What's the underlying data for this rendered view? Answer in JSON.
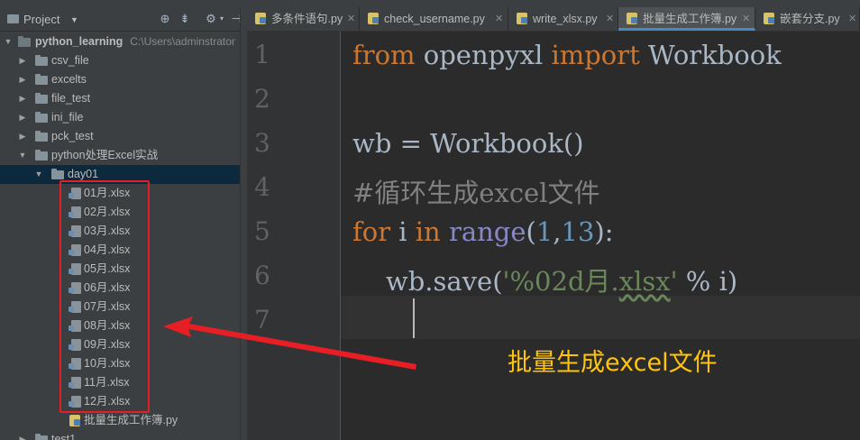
{
  "project_panel": {
    "title": "Project",
    "root": {
      "label": "python_learning",
      "path": "C:\\Users\\adminstrator"
    },
    "folders": [
      "csv_file",
      "excelts",
      "file_test",
      "ini_file",
      "pck_test",
      "python处理Excel实战"
    ],
    "subfolder": "day01",
    "files": [
      "01月.xlsx",
      "02月.xlsx",
      "03月.xlsx",
      "04月.xlsx",
      "05月.xlsx",
      "06月.xlsx",
      "07月.xlsx",
      "08月.xlsx",
      "09月.xlsx",
      "10月.xlsx",
      "11月.xlsx",
      "12月.xlsx"
    ],
    "script": "批量生成工作簿.py",
    "partial_next": "test1"
  },
  "tabs": [
    {
      "label": "多条件语句.py",
      "active": false
    },
    {
      "label": "check_username.py",
      "active": false
    },
    {
      "label": "write_xlsx.py",
      "active": false
    },
    {
      "label": "批量生成工作簿.py",
      "active": true
    },
    {
      "label": "嵌套分支.py",
      "active": false
    }
  ],
  "editor": {
    "line_numbers": [
      "1",
      "2",
      "3",
      "4",
      "5",
      "6",
      "7"
    ],
    "code": {
      "l1_kw1": "from",
      "l1_mod": " openpyxl ",
      "l1_kw2": "import",
      "l1_name": " Workbook",
      "l3": "wb = Workbook()",
      "l4": "#循环生成excel文件",
      "l5_kw1": "for",
      "l5_var": " i ",
      "l5_kw2": "in",
      "l5_sp": " ",
      "l5_fn": "range",
      "l5_p1": "(",
      "l5_n1": "1",
      "l5_c": ",",
      "l5_n2": "13",
      "l5_p2": "):",
      "l6_pre": "    wb.save(",
      "l6_str1": "'%02d月.",
      "l6_str2": "xlsx",
      "l6_str3": "'",
      "l6_post": " % i)"
    }
  },
  "annotation": {
    "label": "批量生成excel文件"
  },
  "colors": {
    "annotation_box": "#e81e25",
    "annotation_text": "#ffc40c",
    "keyword": "#cc7832",
    "comment": "#808080",
    "string": "#6a8759",
    "number": "#6897bb"
  }
}
